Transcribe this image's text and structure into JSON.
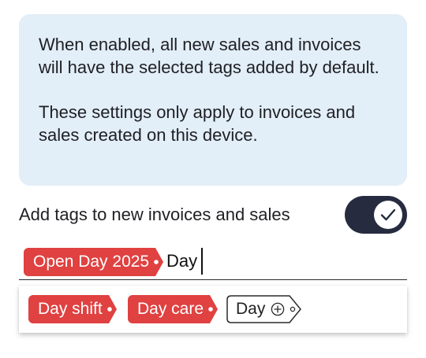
{
  "info": {
    "paragraph1": "When enabled, all new sales and invoices will have the selected tags added by default.",
    "paragraph2": "These settings only apply to invoices and sales created on this device."
  },
  "setting": {
    "label": "Add tags to new invoices and sales",
    "enabled": true,
    "toggle_icon": "check-icon"
  },
  "tag_input": {
    "selected_tags": [
      "Open Day 2025"
    ],
    "typed_value": "Day"
  },
  "suggestions": {
    "existing_tags": [
      "Day shift",
      "Day care"
    ],
    "create_tag_label": "Day",
    "create_icon": "add-circle-icon"
  },
  "colors": {
    "tag_red": "#e04141",
    "toggle_dark": "#262b40",
    "info_background": "#e2eef8"
  }
}
